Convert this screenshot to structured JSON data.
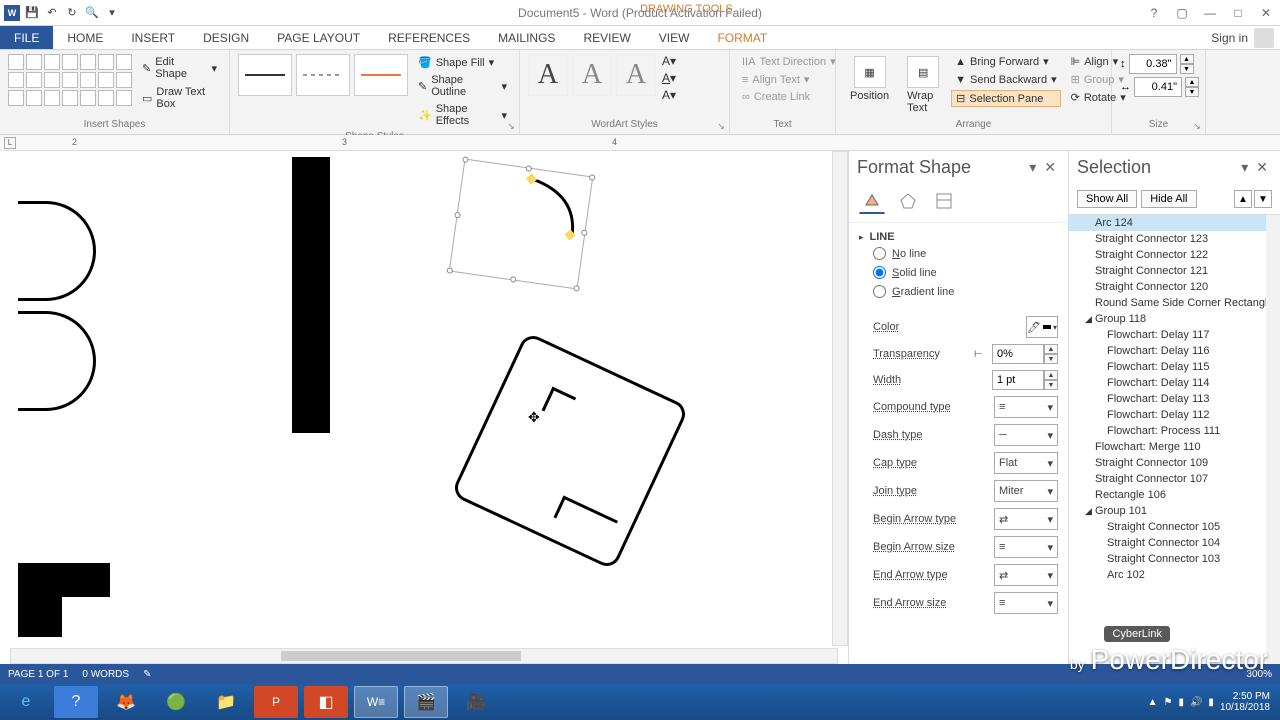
{
  "titlebar": {
    "doc_title": "Document5 - Word (Product Activation Failed)",
    "tool_context": "DRAWING TOOLS"
  },
  "tabs": {
    "file": "FILE",
    "home": "HOME",
    "insert": "INSERT",
    "design": "DESIGN",
    "page_layout": "PAGE LAYOUT",
    "references": "REFERENCES",
    "mailings": "MAILINGS",
    "review": "REVIEW",
    "view": "VIEW",
    "format": "FORMAT",
    "signin": "Sign in"
  },
  "ribbon": {
    "insert_shapes": {
      "label": "Insert Shapes",
      "edit_shape": "Edit Shape",
      "draw_text_box": "Draw Text Box"
    },
    "shape_styles": {
      "label": "Shape Styles",
      "fill": "Shape Fill",
      "outline": "Shape Outline",
      "effects": "Shape Effects"
    },
    "wordart": {
      "label": "WordArt Styles"
    },
    "text": {
      "label": "Text",
      "direction": "Text Direction",
      "align": "Align Text",
      "link": "Create Link"
    },
    "arrange": {
      "label": "Arrange",
      "position": "Position",
      "wrap": "Wrap Text",
      "forward": "Bring Forward",
      "backward": "Send Backward",
      "selection_pane": "Selection Pane",
      "align_btn": "Align",
      "group": "Group",
      "rotate": "Rotate"
    },
    "size": {
      "label": "Size",
      "height": "0.38\"",
      "width": "0.41\""
    }
  },
  "ruler": {
    "m2": "2",
    "m3": "3",
    "m4": "4"
  },
  "format_shape": {
    "title": "Format Shape",
    "section": "LINE",
    "no_line": "No line",
    "solid_line": "Solid line",
    "gradient_line": "Gradient line",
    "color": "Color",
    "transparency": "Transparency",
    "transparency_val": "0%",
    "width": "Width",
    "width_val": "1 pt",
    "compound": "Compound type",
    "dash": "Dash type",
    "cap": "Cap type",
    "cap_val": "Flat",
    "join": "Join type",
    "join_val": "Miter",
    "begin_arrow_type": "Begin Arrow type",
    "begin_arrow_size": "Begin Arrow size",
    "end_arrow_type": "End Arrow type",
    "end_arrow_size": "End Arrow size"
  },
  "selection": {
    "title": "Selection",
    "show_all": "Show All",
    "hide_all": "Hide All",
    "items": [
      {
        "label": "Arc 124",
        "indent": 1,
        "selected": true
      },
      {
        "label": "Straight Connector 123",
        "indent": 1
      },
      {
        "label": "Straight Connector 122",
        "indent": 1
      },
      {
        "label": "Straight Connector 121",
        "indent": 1
      },
      {
        "label": "Straight Connector 120",
        "indent": 1
      },
      {
        "label": "Round Same Side Corner Rectangle",
        "indent": 1
      },
      {
        "label": "Group 118",
        "indent": 1,
        "expandable": true
      },
      {
        "label": "Flowchart: Delay 117",
        "indent": 2
      },
      {
        "label": "Flowchart: Delay 116",
        "indent": 2
      },
      {
        "label": "Flowchart: Delay 115",
        "indent": 2
      },
      {
        "label": "Flowchart: Delay 114",
        "indent": 2
      },
      {
        "label": "Flowchart: Delay 113",
        "indent": 2
      },
      {
        "label": "Flowchart: Delay 112",
        "indent": 2
      },
      {
        "label": "Flowchart: Process 111",
        "indent": 2
      },
      {
        "label": "Flowchart: Merge 110",
        "indent": 1
      },
      {
        "label": "Straight Connector 109",
        "indent": 1
      },
      {
        "label": "Straight Connector 107",
        "indent": 1
      },
      {
        "label": "Rectangle 106",
        "indent": 1
      },
      {
        "label": "Group 101",
        "indent": 1,
        "expandable": true
      },
      {
        "label": "Straight Connector 105",
        "indent": 2
      },
      {
        "label": "Straight Connector 104",
        "indent": 2
      },
      {
        "label": "Straight Connector 103",
        "indent": 2
      },
      {
        "label": "Arc 102",
        "indent": 2
      }
    ]
  },
  "statusbar": {
    "page": "PAGE 1 OF 1",
    "words": "0 WORDS",
    "zoom": "300%"
  },
  "taskbar": {
    "time": "2:50 PM",
    "date": "10/18/2018"
  },
  "watermark": {
    "brand": "CyberLink",
    "by": "by",
    "product": "PowerDirector"
  }
}
